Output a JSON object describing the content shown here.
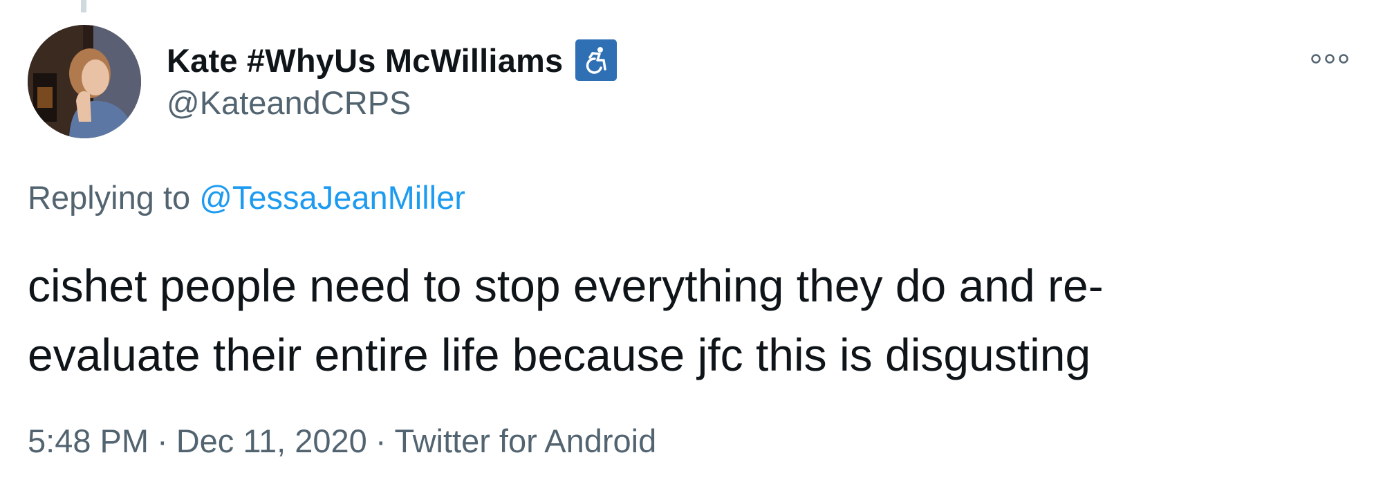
{
  "author": {
    "display_name": "Kate #WhyUs McWilliams",
    "handle": "@KateandCRPS",
    "name_badge_icon": "wheelchair-icon",
    "badge_color": "#2f6fb3"
  },
  "reply": {
    "prefix": "Replying to",
    "mention": "@TessaJeanMiller"
  },
  "tweet": {
    "text_lines": [
      "cishet people need to stop everything they do and re-",
      "evaluate their entire life because jfc this is disgusting"
    ]
  },
  "meta": {
    "time": "5:48 PM",
    "separator": "·",
    "date": "Dec 11, 2020",
    "source": "Twitter for Android"
  },
  "menu": {
    "more_icon": "more-options-icon"
  },
  "colors": {
    "text": "#0f1419",
    "secondary": "#536471",
    "link": "#1d9bf0"
  }
}
